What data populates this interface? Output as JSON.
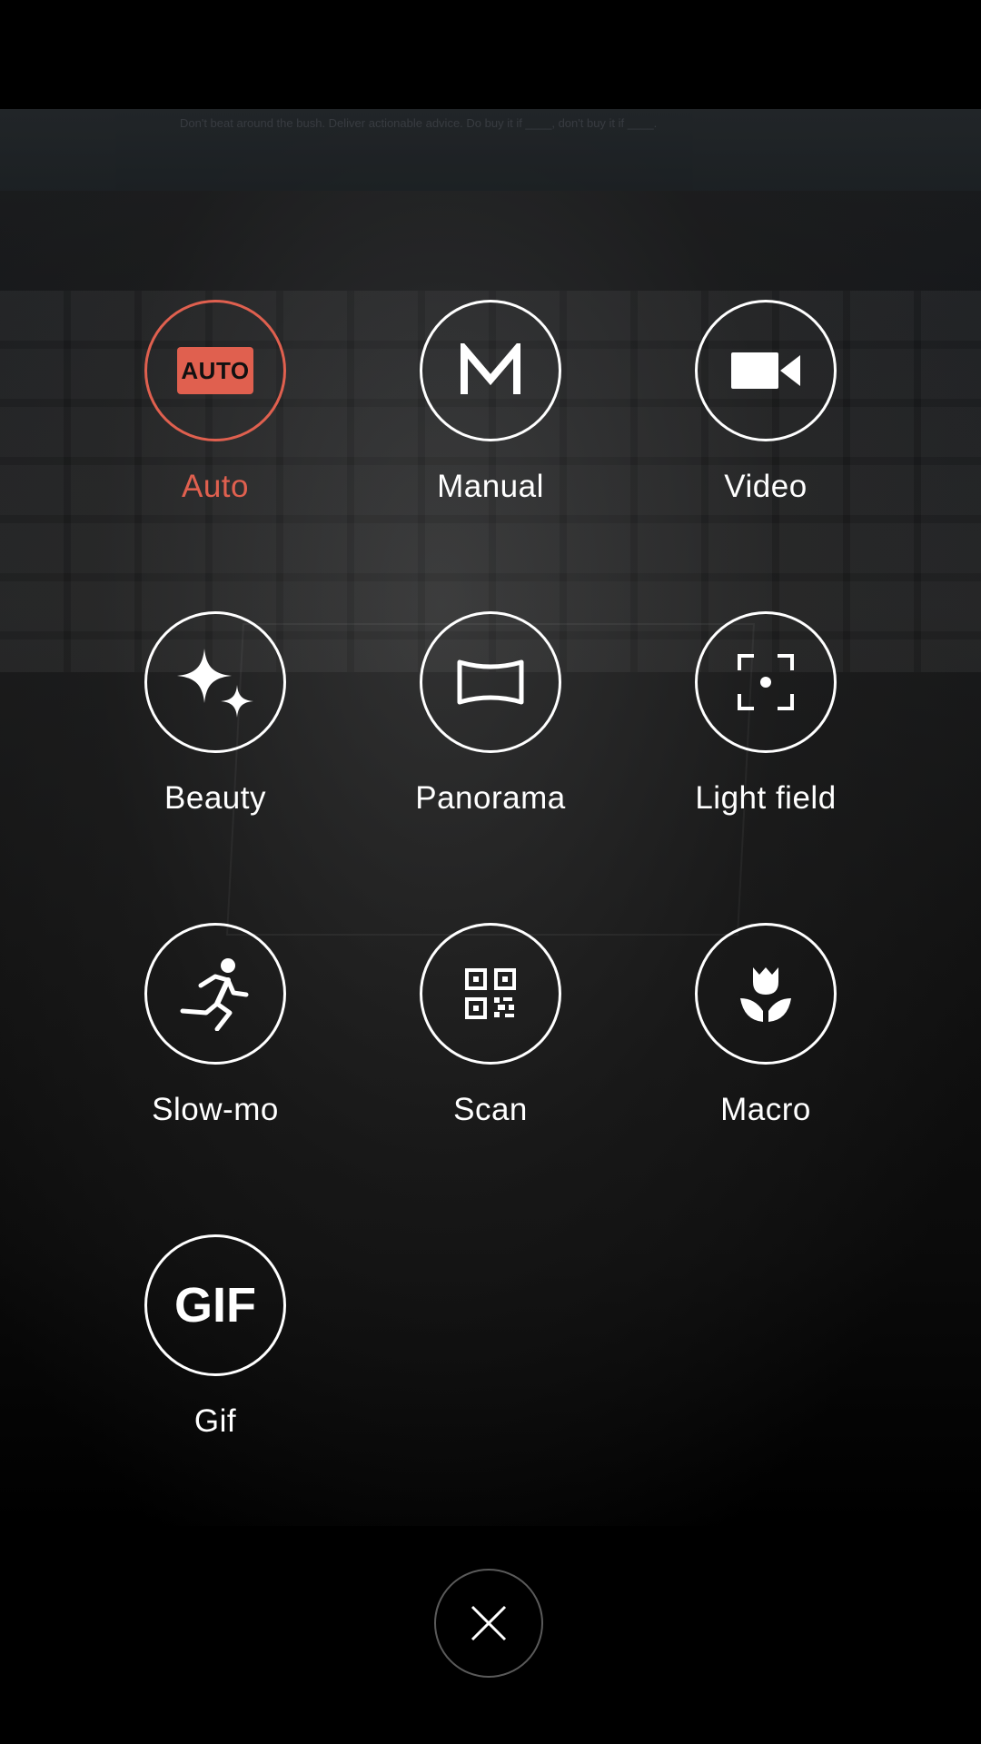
{
  "preview": {
    "screen_text": "Don't beat around the bush. Deliver actionable advice. Do buy it if ____, don't buy it if ____."
  },
  "modes": [
    {
      "label": "Auto",
      "icon": "auto-icon",
      "badge_text": "AUTO",
      "selected": true
    },
    {
      "label": "Manual",
      "icon": "manual-m-icon",
      "selected": false
    },
    {
      "label": "Video",
      "icon": "video-camera-icon",
      "selected": false
    },
    {
      "label": "Beauty",
      "icon": "sparkle-icon",
      "selected": false
    },
    {
      "label": "Panorama",
      "icon": "panorama-icon",
      "selected": false
    },
    {
      "label": "Light field",
      "icon": "focus-frame-icon",
      "selected": false
    },
    {
      "label": "Slow-mo",
      "icon": "running-person-icon",
      "selected": false
    },
    {
      "label": "Scan",
      "icon": "qr-code-icon",
      "selected": false
    },
    {
      "label": "Macro",
      "icon": "tulip-flower-icon",
      "selected": false
    },
    {
      "label": "Gif",
      "icon": "gif-icon",
      "badge_text": "GIF",
      "selected": false
    }
  ],
  "close_button": {
    "icon": "close-icon"
  },
  "colors": {
    "accent": "#e0604f",
    "icon": "#ffffff",
    "background": "#000000"
  }
}
